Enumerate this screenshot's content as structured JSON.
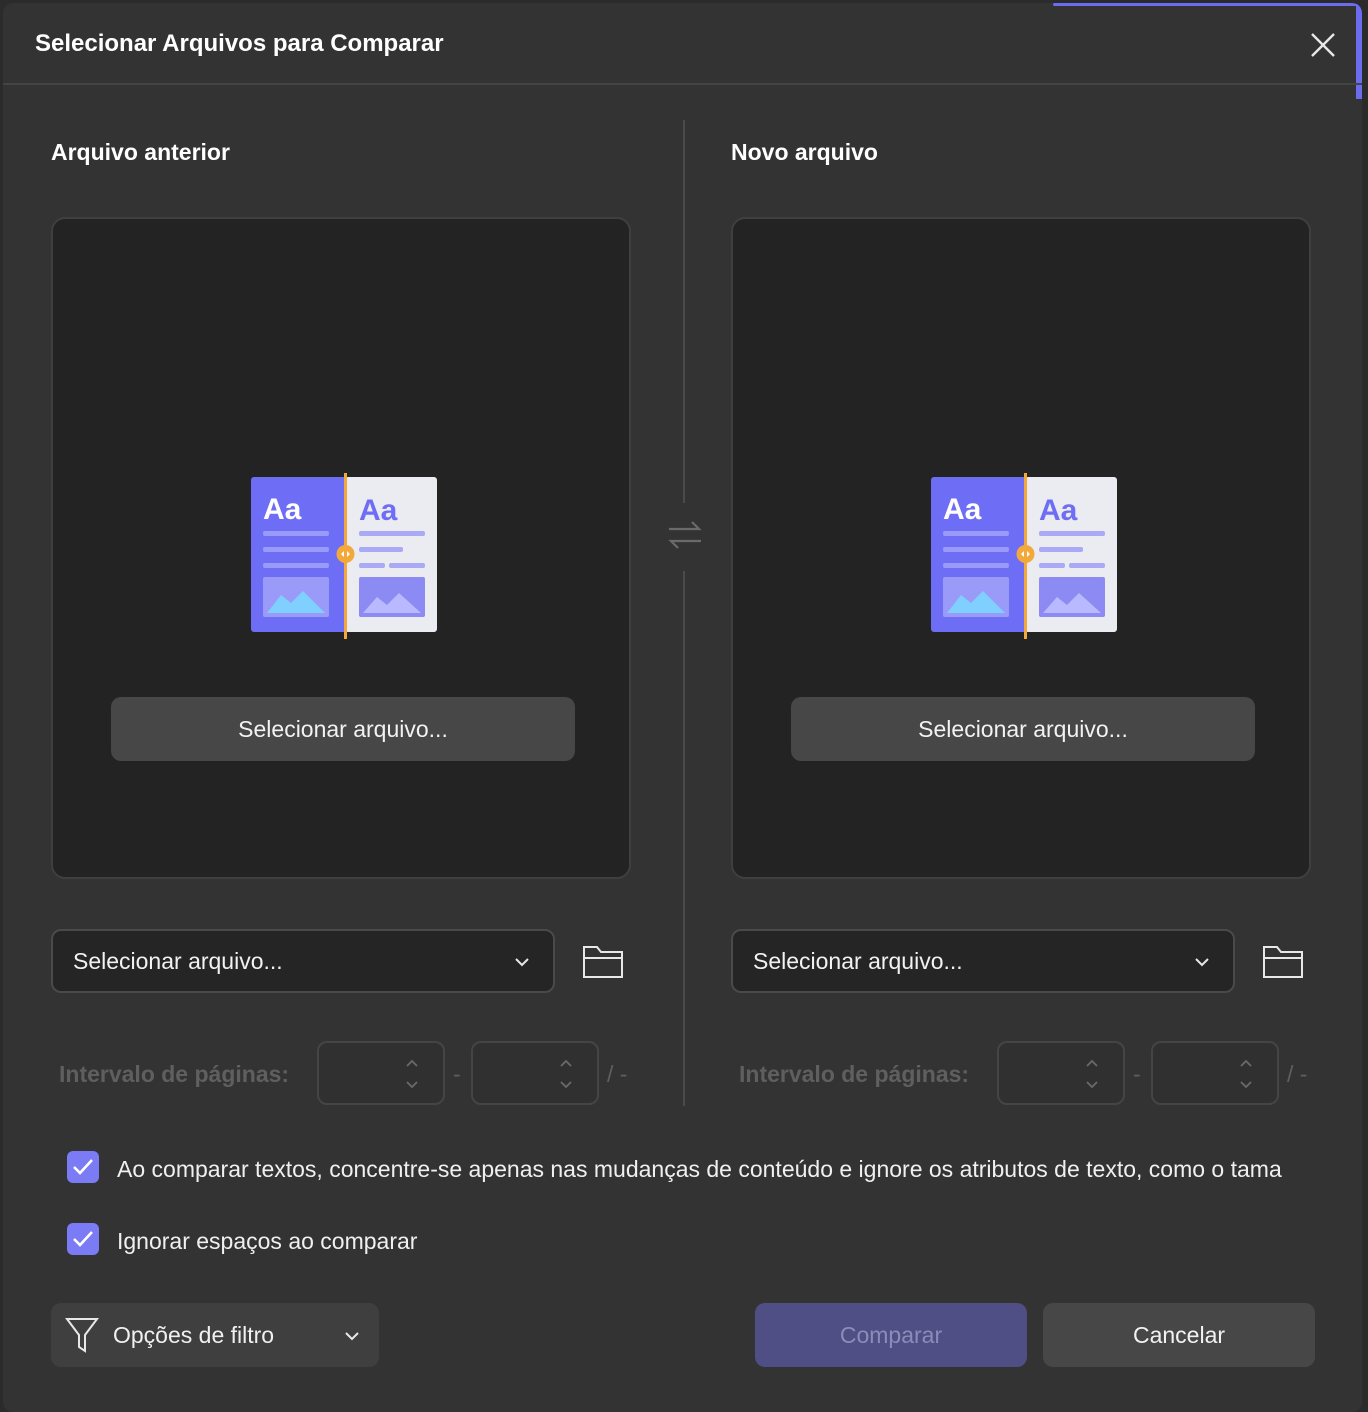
{
  "dialog": {
    "title": "Selecionar Arquivos para Comparar",
    "close_icon": "close-icon"
  },
  "left": {
    "title": "Arquivo anterior",
    "select_button": "Selecionar arquivo...",
    "dropdown_value": "Selecionar arquivo...",
    "range_label": "Intervalo de páginas:",
    "range_from": "",
    "range_to": "",
    "range_separator": "-",
    "range_total": "/ -"
  },
  "right": {
    "title": "Novo arquivo",
    "select_button": "Selecionar arquivo...",
    "dropdown_value": "Selecionar arquivo...",
    "range_label": "Intervalo de páginas:",
    "range_from": "",
    "range_to": "",
    "range_separator": "-",
    "range_total": "/ -"
  },
  "options": {
    "focus_content": {
      "label": "Ao comparar textos, concentre-se apenas nas mudanças de conteúdo e ignore os atributos de texto, como o tama",
      "checked": true
    },
    "ignore_spaces": {
      "label": "Ignorar espaços ao comparar",
      "checked": true
    }
  },
  "footer": {
    "filter_label": "Opções de filtro",
    "compare_label": "Comparar",
    "cancel_label": "Cancelar"
  },
  "colors": {
    "accent": "#7b7bf5",
    "compare_disabled": "#4f4f86",
    "background": "#333333"
  }
}
